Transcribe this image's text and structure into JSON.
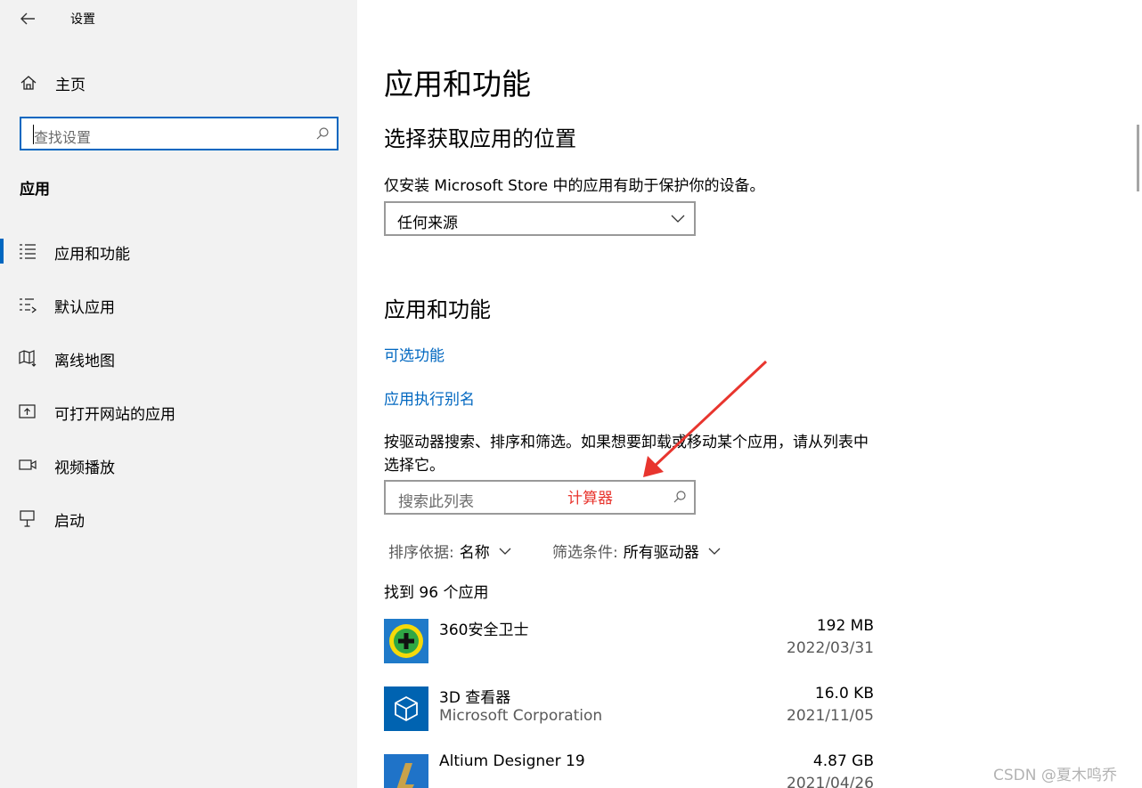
{
  "window": {
    "title": "设置"
  },
  "sidebar": {
    "home_label": "主页",
    "search_placeholder": "查找设置",
    "section_title": "应用",
    "items": [
      {
        "label": "应用和功能",
        "icon": "apps-features-icon",
        "selected": true
      },
      {
        "label": "默认应用",
        "icon": "default-apps-icon"
      },
      {
        "label": "离线地图",
        "icon": "offline-maps-icon"
      },
      {
        "label": "可打开网站的应用",
        "icon": "apps-for-websites-icon"
      },
      {
        "label": "视频播放",
        "icon": "video-playback-icon"
      },
      {
        "label": "启动",
        "icon": "startup-icon"
      }
    ]
  },
  "main": {
    "page_title": "应用和功能",
    "install_section": {
      "title": "选择获取应用的位置",
      "description": "仅安装 Microsoft Store 中的应用有助于保护你的设备。",
      "dropdown_value": "任何来源"
    },
    "apps_section": {
      "title": "应用和功能",
      "optional_features_link": "可选功能",
      "app_alias_link": "应用执行别名",
      "instructions_line1": "按驱动器搜索、排序和筛选。如果想要卸载或移动某个应用，请从列表中",
      "instructions_line2": "选择它。",
      "list_search_placeholder": "搜索此列表",
      "sort_label": "排序依据:",
      "sort_value": "名称",
      "filter_label": "筛选条件:",
      "filter_value": "所有驱动器",
      "found_count": "找到 96 个应用",
      "apps": [
        {
          "name": "360安全卫士",
          "publisher": "",
          "size": "192 MB",
          "date": "2022/03/31",
          "icon": "360-safe-icon"
        },
        {
          "name": "3D 查看器",
          "publisher": "Microsoft Corporation",
          "size": "16.0 KB",
          "date": "2021/11/05",
          "icon": "3d-viewer-icon"
        },
        {
          "name": "Altium Designer 19",
          "publisher": "",
          "size": "4.87 GB",
          "date": "2021/04/26",
          "icon": "altium-designer-icon"
        }
      ]
    }
  },
  "annotation": {
    "text": "计算器",
    "color": "#e8352e"
  },
  "watermark": "CSDN @夏木鸣乔",
  "colors": {
    "accent": "#0067c0",
    "sidebar_bg": "#f2f2f2",
    "annotation_red": "#e8352e"
  }
}
